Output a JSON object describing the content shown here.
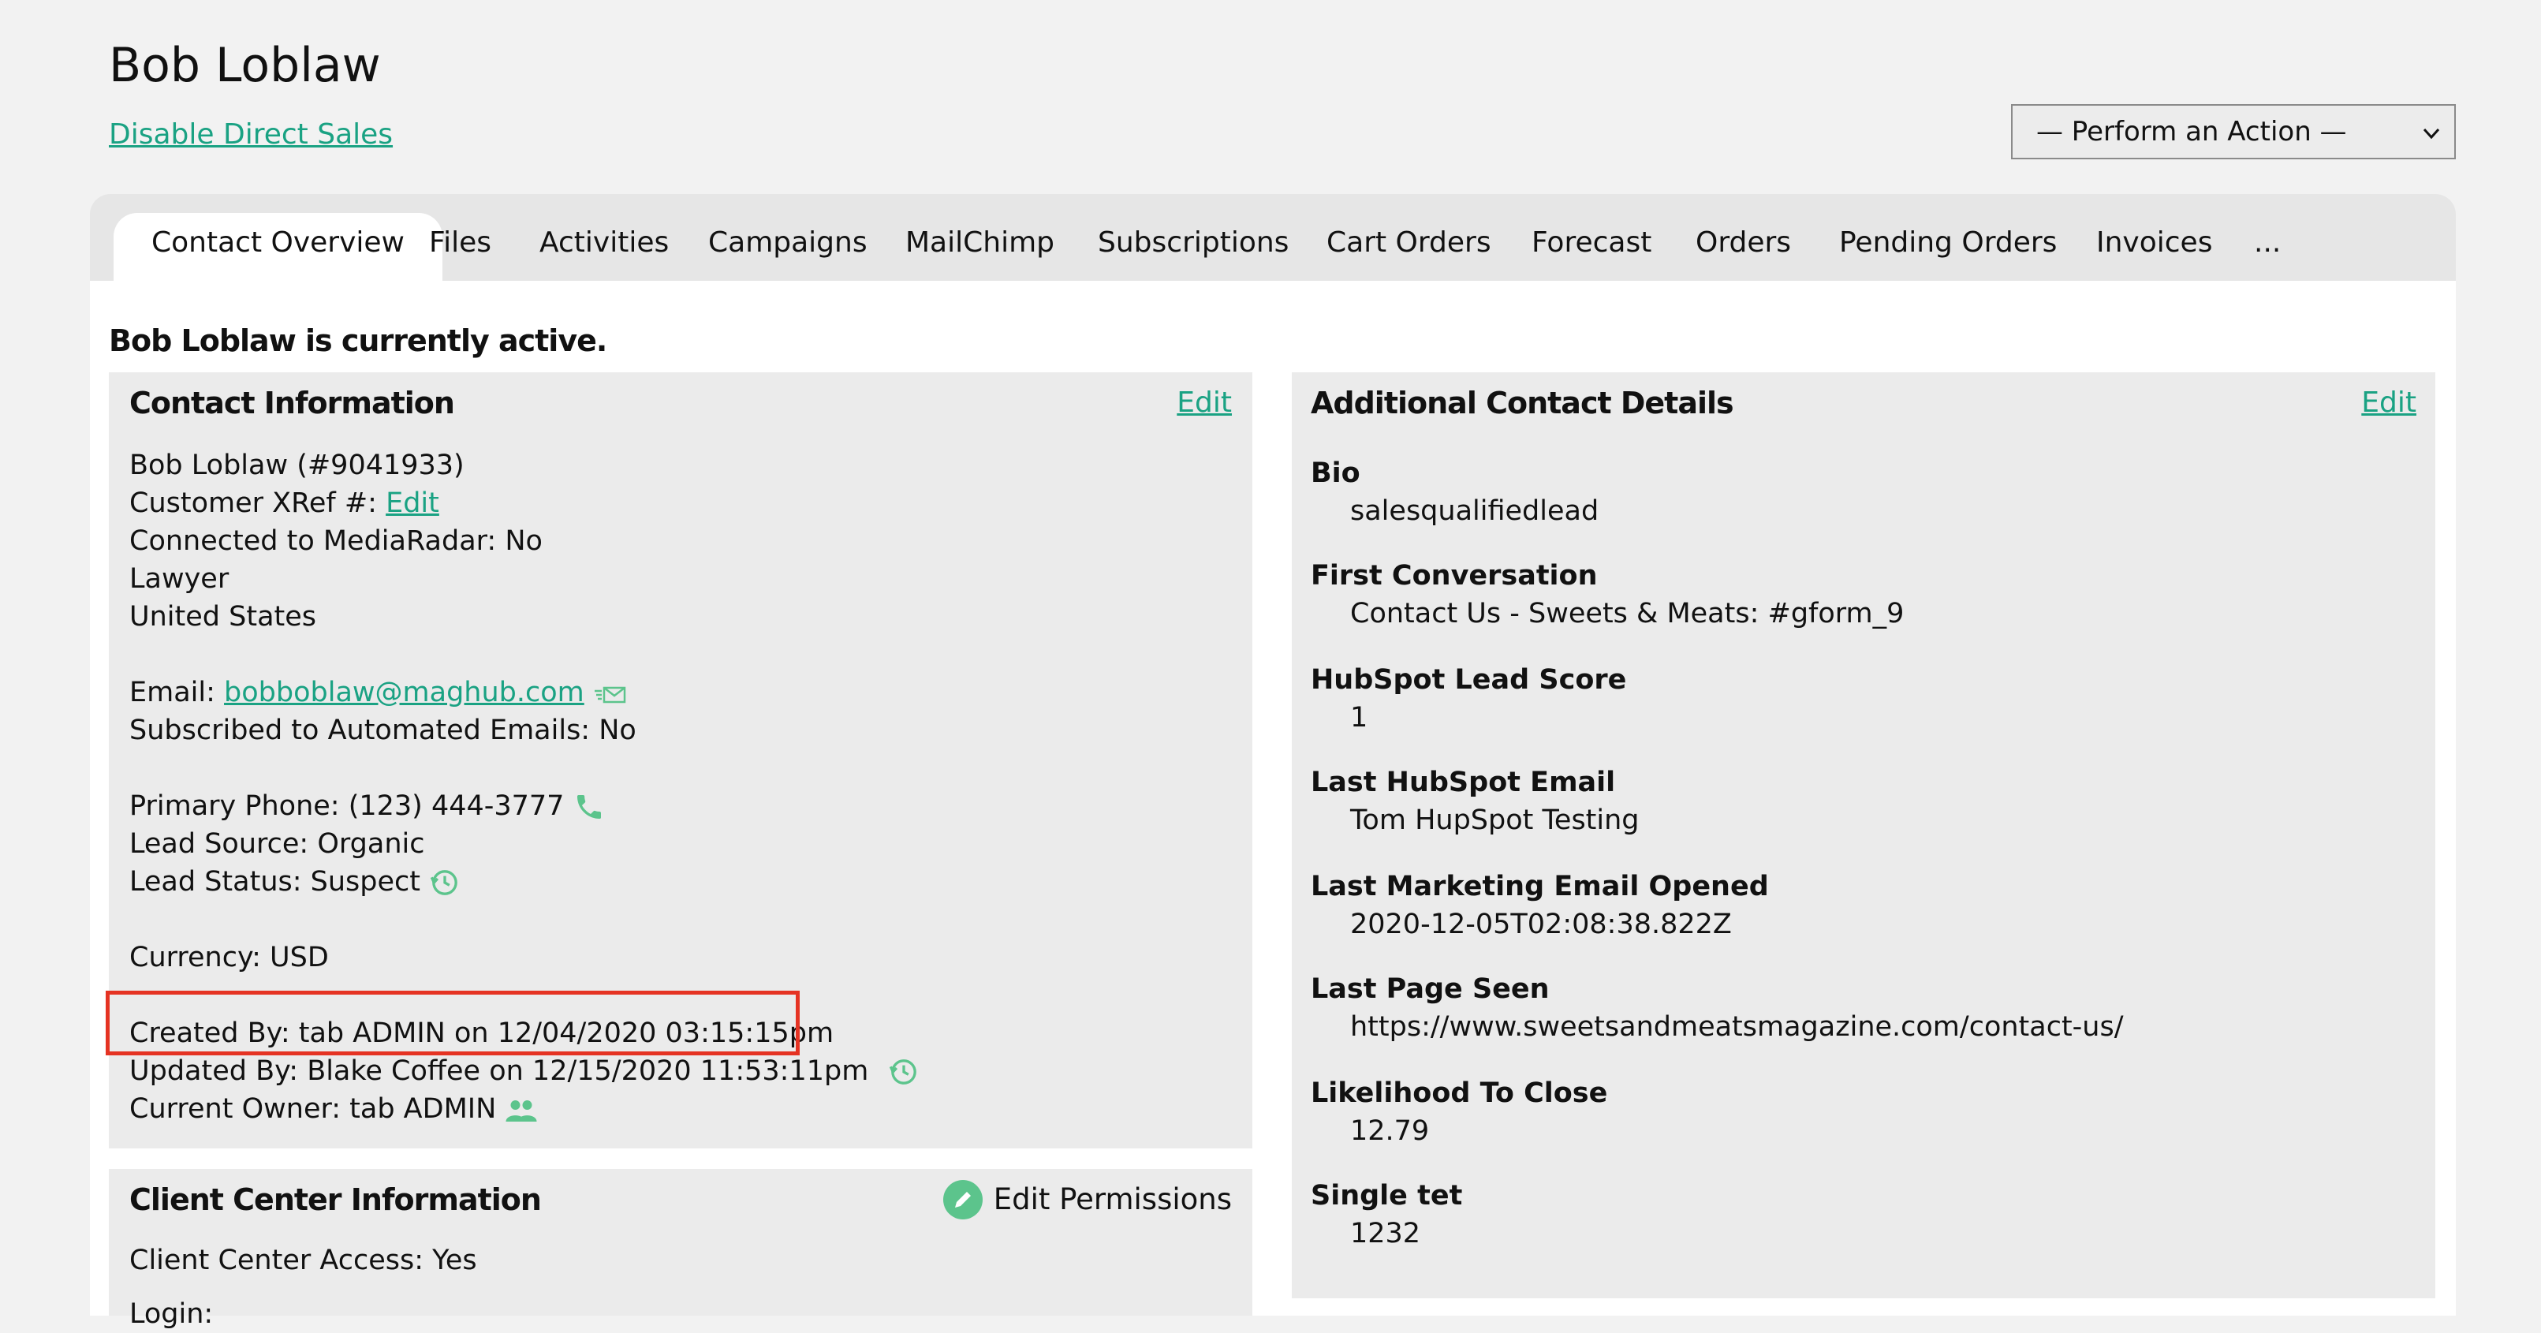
{
  "header": {
    "title": "Bob Loblaw",
    "disable_link": "Disable Direct Sales",
    "action_select": "— Perform an Action —"
  },
  "tabs": [
    {
      "label": "Contact Overview"
    },
    {
      "label": "Files"
    },
    {
      "label": "Activities"
    },
    {
      "label": "Campaigns"
    },
    {
      "label": "MailChimp"
    },
    {
      "label": "Subscriptions"
    },
    {
      "label": "Cart Orders"
    },
    {
      "label": "Forecast"
    },
    {
      "label": "Orders"
    },
    {
      "label": "Pending Orders"
    },
    {
      "label": "Invoices"
    },
    {
      "label": "..."
    }
  ],
  "status": "Bob Loblaw is currently active.",
  "contact": {
    "title": "Contact Information",
    "edit": "Edit",
    "name_line": "Bob Loblaw (#9041933)",
    "xref_label": "Customer XRef #: ",
    "xref_link": "Edit",
    "mediaradar": "Connected to MediaRadar: No",
    "title_line": "Lawyer",
    "country": "United States",
    "email_label": "Email: ",
    "email": "bobboblaw@maghub.com",
    "subscribed": "Subscribed to Automated Emails: No",
    "phone": "Primary Phone: (123) 444-3777",
    "lead_source": "Lead Source: Organic",
    "lead_status": "Lead Status: Suspect",
    "currency": "Currency: USD",
    "created_by": "Created By: tab ADMIN on 12/04/2020 03:15:15pm",
    "updated_by": "Updated By: Blake Coffee on 12/15/2020 11:53:11pm",
    "owner": "Current Owner: tab ADMIN"
  },
  "client_center": {
    "title": "Client Center Information",
    "edit_permissions": "Edit Permissions",
    "access": "Client Center Access: Yes",
    "login": "Login:"
  },
  "additional": {
    "title": "Additional Contact Details",
    "edit": "Edit",
    "fields": [
      {
        "label": "Bio",
        "value": "salesqualifiedlead"
      },
      {
        "label": "First Conversation",
        "value": "Contact Us - Sweets & Meats: #gform_9"
      },
      {
        "label": "HubSpot Lead Score",
        "value": "1"
      },
      {
        "label": "Last HubSpot Email",
        "value": "Tom HupSpot Testing"
      },
      {
        "label": "Last Marketing Email Opened",
        "value": "2020-12-05T02:08:38.822Z"
      },
      {
        "label": "Last Page Seen",
        "value": "https://www.sweetsandmeatsmagazine.com/contact-us/"
      },
      {
        "label": "Likelihood To Close",
        "value": "12.79"
      },
      {
        "label": "Single tet",
        "value": "1232"
      }
    ]
  },
  "colors": {
    "accent": "#1aa283",
    "highlight": "#e53323",
    "icon_green": "#5cc48c"
  }
}
